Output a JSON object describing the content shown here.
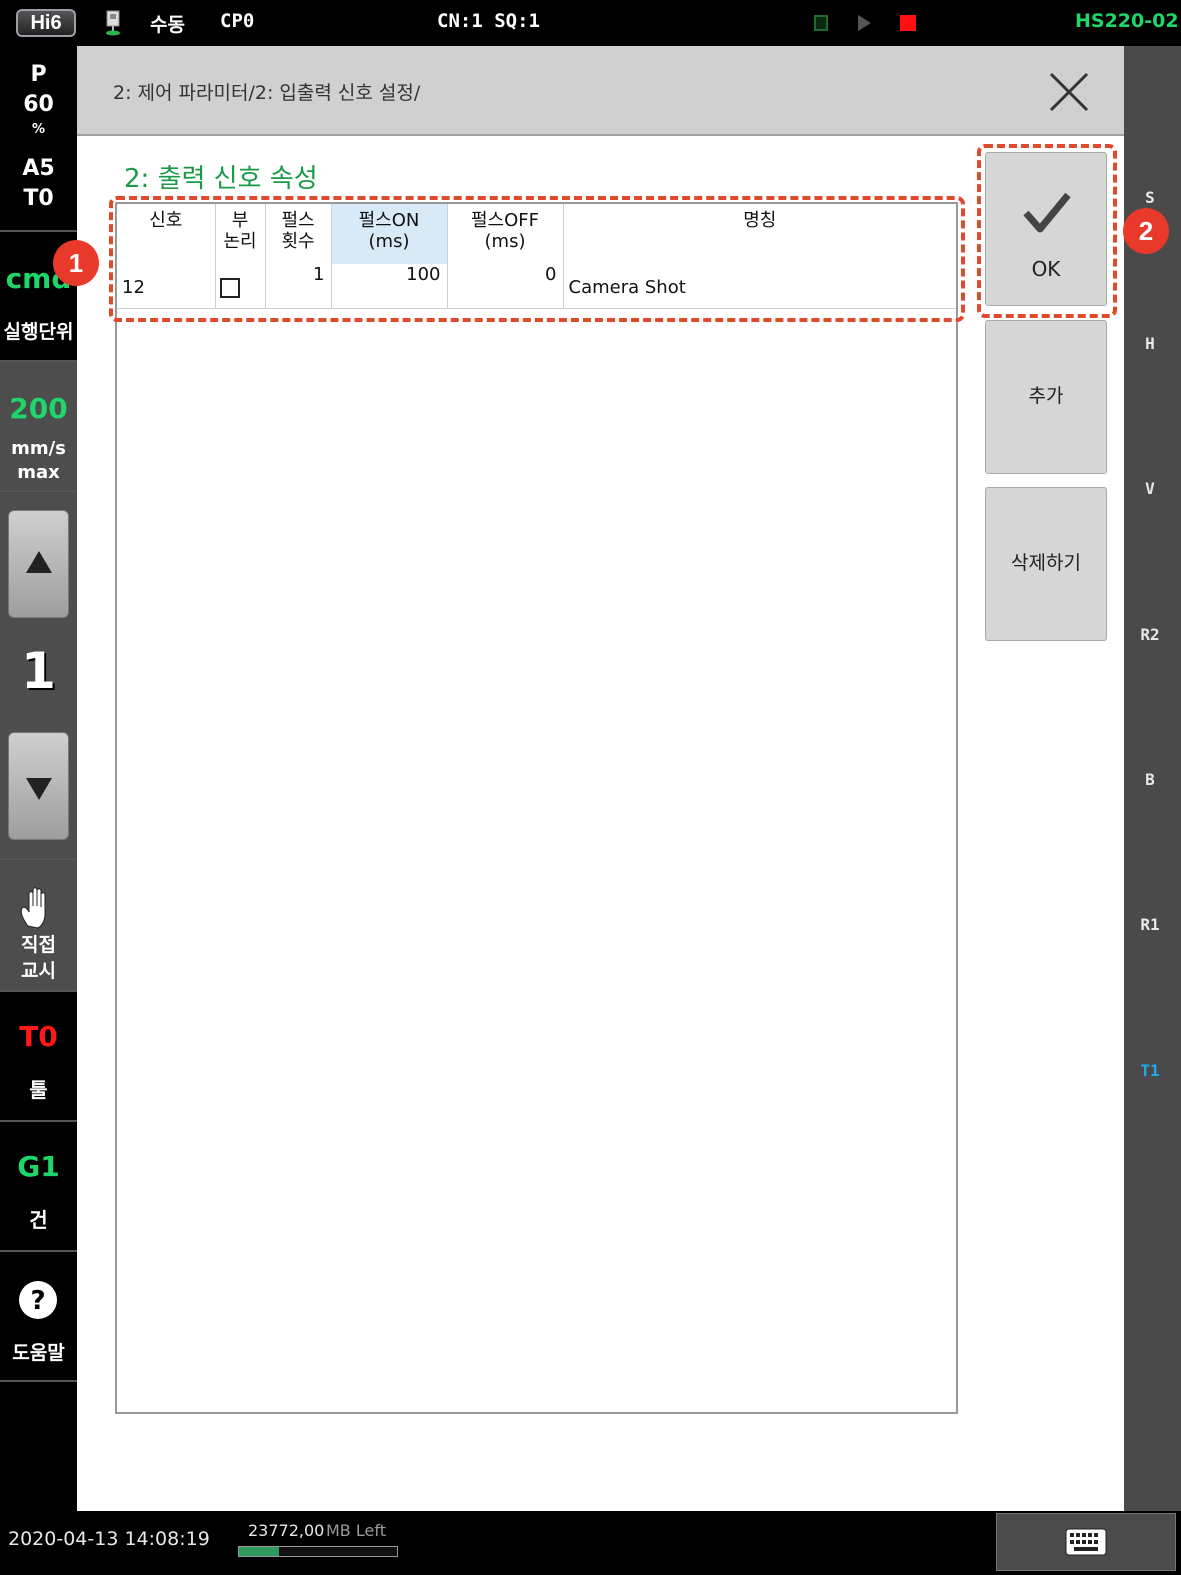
{
  "topbar": {
    "logo": "Hi6",
    "mode": "수동",
    "program": "CP0",
    "cn_sq": "CN:1 SQ:1",
    "model": "HS220-02",
    "icons": [
      "pendant-icon",
      "run-status-icon",
      "play-icon",
      "stop-icon"
    ],
    "colors": {
      "model": "#1fd66b",
      "stop": "#ff1111"
    }
  },
  "leftpanel": {
    "p_label": "P",
    "p_value": "60",
    "p_unit": "%",
    "a_value": "A5",
    "t_value": "T0",
    "cmd_label": "cmd",
    "exec_unit": "실행단위",
    "speed": "200",
    "speed_unit": "mm/s",
    "speed_max": "max",
    "step_value": "1",
    "direct_teach_1": "직접",
    "direct_teach_2": "교시",
    "tool_value": "T0",
    "tool_label": "툴",
    "gun_value": "G1",
    "gun_label": "건",
    "help_label": "도움말"
  },
  "rightstrip": {
    "labels": [
      "S",
      "H",
      "V",
      "R2",
      "B",
      "R1",
      "T1"
    ],
    "active": "T1"
  },
  "main": {
    "breadcrumb": "2: 제어 파라미터/2: 입출력 신호 설정/",
    "section_title": "2: 출력 신호 속성",
    "columns": [
      {
        "line1": "신호",
        "line2": ""
      },
      {
        "line1": "부",
        "line2": "논리"
      },
      {
        "line1": "펄스",
        "line2": "횟수"
      },
      {
        "line1": "펄스ON",
        "line2": "(ms)"
      },
      {
        "line1": "펄스OFF",
        "line2": "(ms)"
      },
      {
        "line1": "명칭",
        "line2": ""
      }
    ],
    "rows": [
      {
        "signal": "12",
        "negative_logic": false,
        "pulse_count": "1",
        "pulse_on": "100",
        "pulse_off": "0",
        "name": "Camera Shot"
      }
    ],
    "buttons": {
      "ok": "OK",
      "add": "추가",
      "delete": "삭제하기"
    },
    "badges": [
      "1",
      "2"
    ],
    "colors": {
      "section_title": "#1a9a47",
      "annotation": "#e04a2c"
    }
  },
  "bottombar": {
    "datetime": "2020-04-13 14:08:19",
    "disk_value": "23772,00",
    "disk_unit": "MB Left",
    "disk_used_fraction": 0.25
  }
}
